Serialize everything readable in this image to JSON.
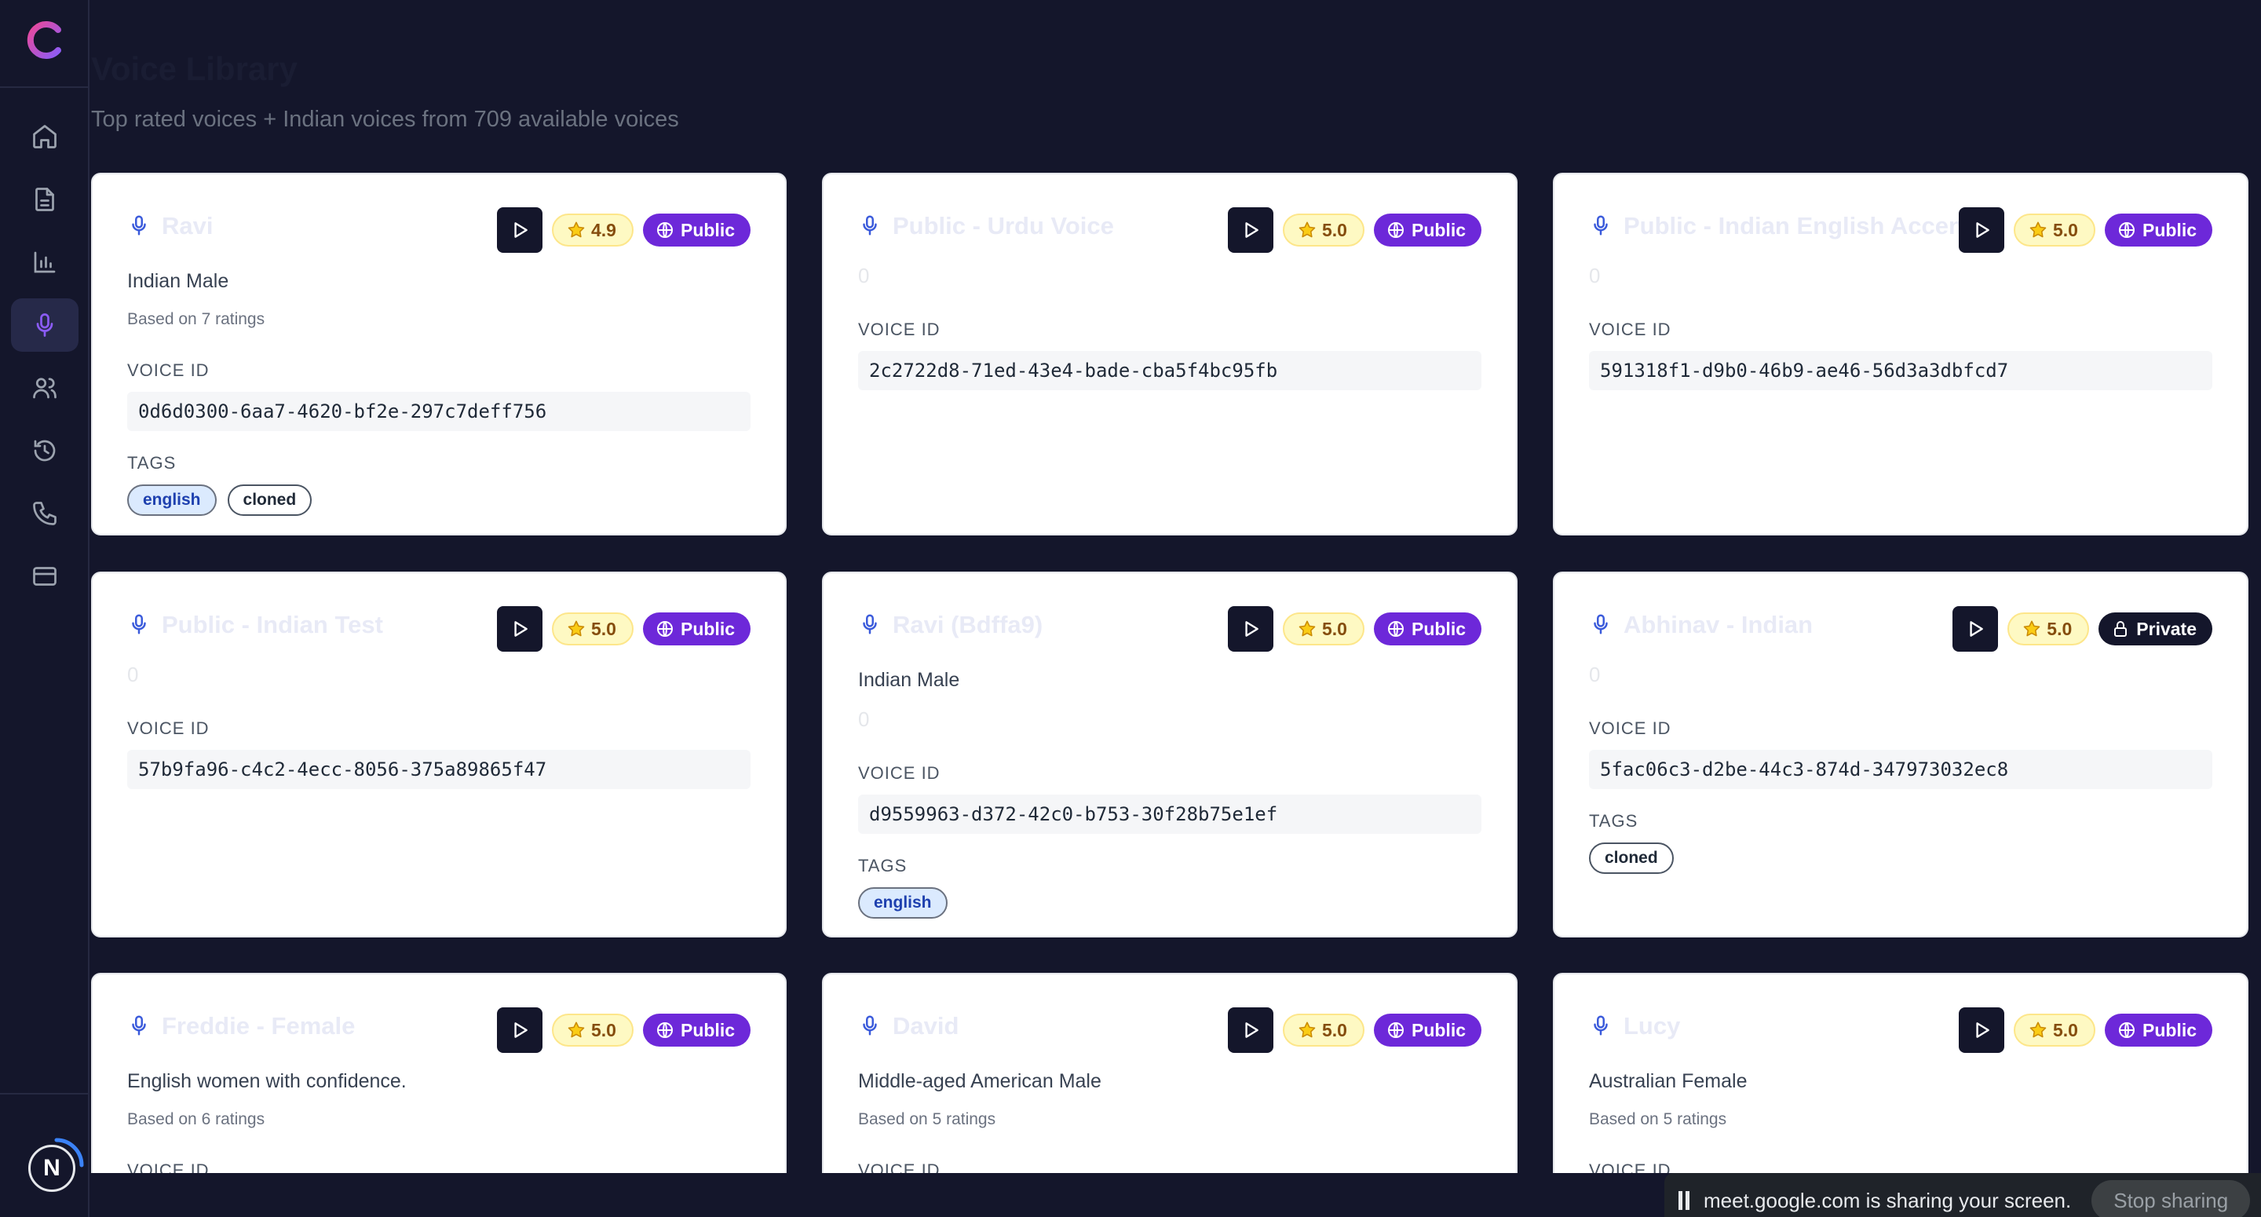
{
  "header": {
    "title": "Voice Library",
    "subtitle": "Top rated voices + Indian voices from 709 available voices"
  },
  "sidebar": {
    "items": [
      {
        "icon": "home-icon"
      },
      {
        "icon": "document-icon"
      },
      {
        "icon": "chart-icon"
      },
      {
        "icon": "microphone-icon",
        "active": true
      },
      {
        "icon": "users-icon"
      },
      {
        "icon": "history-icon"
      },
      {
        "icon": "phone-icon"
      },
      {
        "icon": "credit-card-icon"
      }
    ],
    "avatar_initial": "N"
  },
  "labels": {
    "voice_id": "VOICE ID",
    "tags": "TAGS"
  },
  "cards": [
    {
      "name": "Ravi",
      "rating": "4.9",
      "visibility": "Public",
      "description": "Indian Male",
      "ratings_text": "Based on 7 ratings",
      "voice_id": "0d6d0300-6aa7-4620-bf2e-297c7deff756",
      "tags": [
        "english",
        "cloned"
      ]
    },
    {
      "name": "Public - Urdu Voice",
      "rating": "5.0",
      "visibility": "Public",
      "description": "",
      "ratings_text": "0",
      "voice_id": "2c2722d8-71ed-43e4-bade-cba5f4bc95fb",
      "tags": []
    },
    {
      "name": "Public - Indian English Accent",
      "rating": "5.0",
      "visibility": "Public",
      "description": "",
      "ratings_text": "0",
      "voice_id": "591318f1-d9b0-46b9-ae46-56d3a3dbfcd7",
      "tags": []
    },
    {
      "name": "Public - Indian Test",
      "rating": "5.0",
      "visibility": "Public",
      "description": "",
      "ratings_text": "0",
      "voice_id": "57b9fa96-c4c2-4ecc-8056-375a89865f47",
      "tags": []
    },
    {
      "name": "Ravi (Bdffa9)",
      "rating": "5.0",
      "visibility": "Public",
      "description": "Indian Male",
      "ratings_text": "0",
      "voice_id": "d9559963-d372-42c0-b753-30f28b75e1ef",
      "tags": [
        "english"
      ]
    },
    {
      "name": "Abhinav - Indian",
      "rating": "5.0",
      "visibility": "Private",
      "description": "",
      "ratings_text": "0",
      "voice_id": "5fac06c3-d2be-44c3-874d-347973032ec8",
      "tags": [
        "cloned"
      ]
    },
    {
      "name": "Freddie - Female",
      "rating": "5.0",
      "visibility": "Public",
      "description": "English women with confidence.",
      "ratings_text": "Based on 6 ratings",
      "voice_id": "",
      "tags": []
    },
    {
      "name": "David",
      "rating": "5.0",
      "visibility": "Public",
      "description": "Middle-aged American Male",
      "ratings_text": "Based on 5 ratings",
      "voice_id": "",
      "tags": []
    },
    {
      "name": "Lucy",
      "rating": "5.0",
      "visibility": "Public",
      "description": "Australian Female",
      "ratings_text": "Based on 5 ratings",
      "voice_id": "",
      "tags": []
    }
  ],
  "share_bar": {
    "message": "meet.google.com is sharing your screen.",
    "stop_label": "Stop sharing"
  },
  "colors": {
    "background": "#14162b",
    "accent": "#6d28d9",
    "rating_bg": "#fef9c3"
  }
}
